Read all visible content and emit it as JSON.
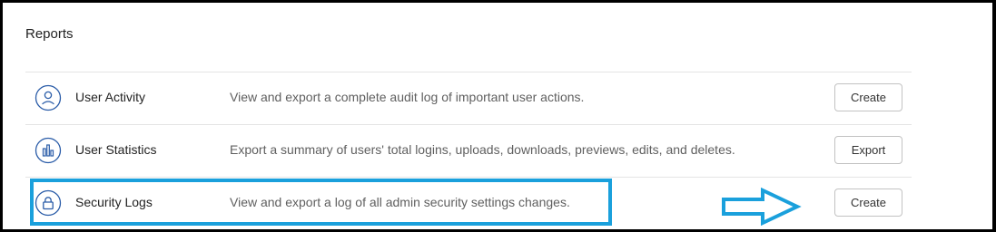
{
  "section": {
    "title": "Reports"
  },
  "reports": [
    {
      "name": "User Activity",
      "description": "View and export a complete audit log of important user actions.",
      "action": "Create",
      "icon": "user-icon"
    },
    {
      "name": "User Statistics",
      "description": "Export a summary of users' total logins, uploads, downloads, previews, edits, and deletes.",
      "action": "Export",
      "icon": "bar-chart-icon"
    },
    {
      "name": "Security Logs",
      "description": "View and export a log of all admin security settings changes.",
      "action": "Create",
      "icon": "lock-icon"
    }
  ],
  "colors": {
    "icon": "#2a5ca8",
    "highlight": "#1aa0dc"
  }
}
